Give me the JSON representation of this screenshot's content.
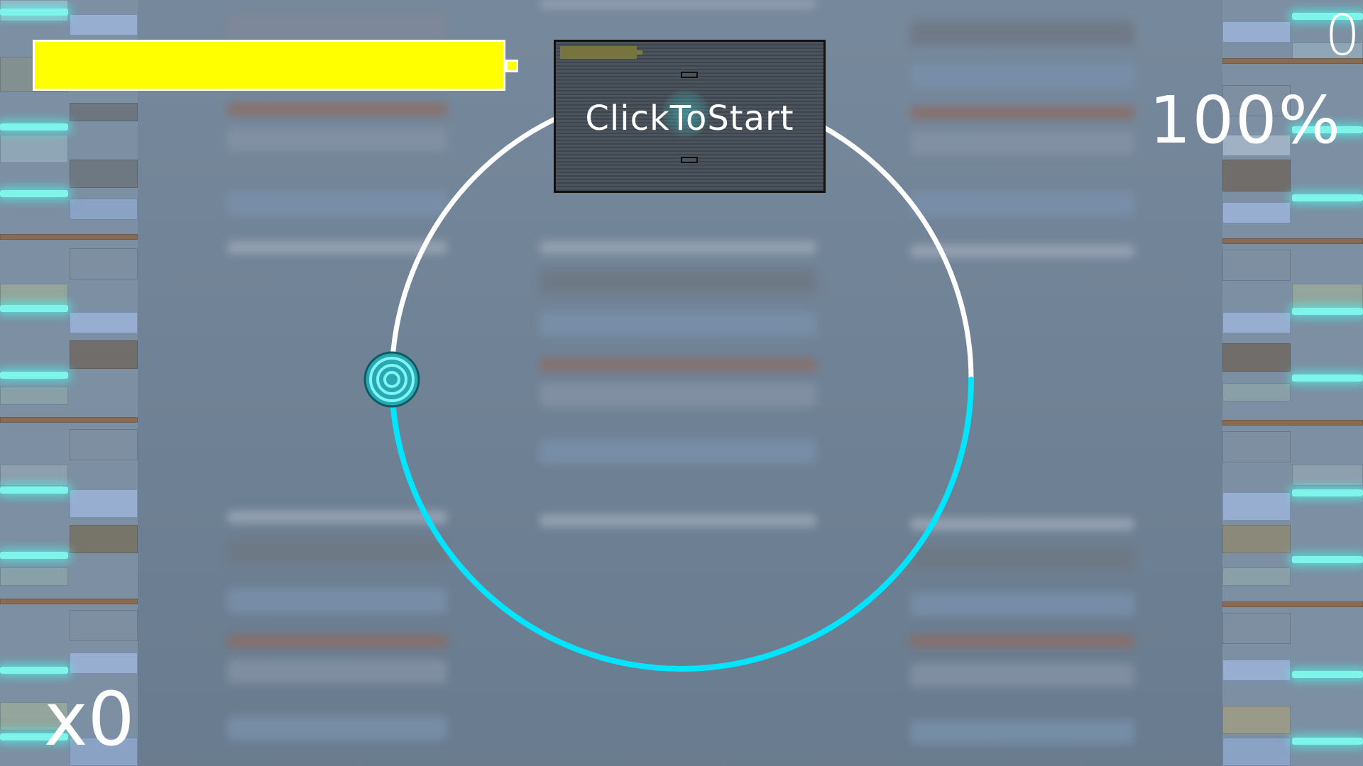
{
  "hud": {
    "score": "0",
    "accuracy": "100%",
    "combo": "x0",
    "health_fraction": 1.0
  },
  "start_panel": {
    "label": "ClickToStart"
  },
  "ring": {
    "progress_fraction": 0.5,
    "colors": {
      "track": "#ffffff",
      "progress": "#00e5ff",
      "cursor": "#1ce0e8"
    }
  },
  "colors": {
    "health": "#ffff00",
    "background": "#6f8296",
    "lane_glow": "#7ff4ea"
  }
}
